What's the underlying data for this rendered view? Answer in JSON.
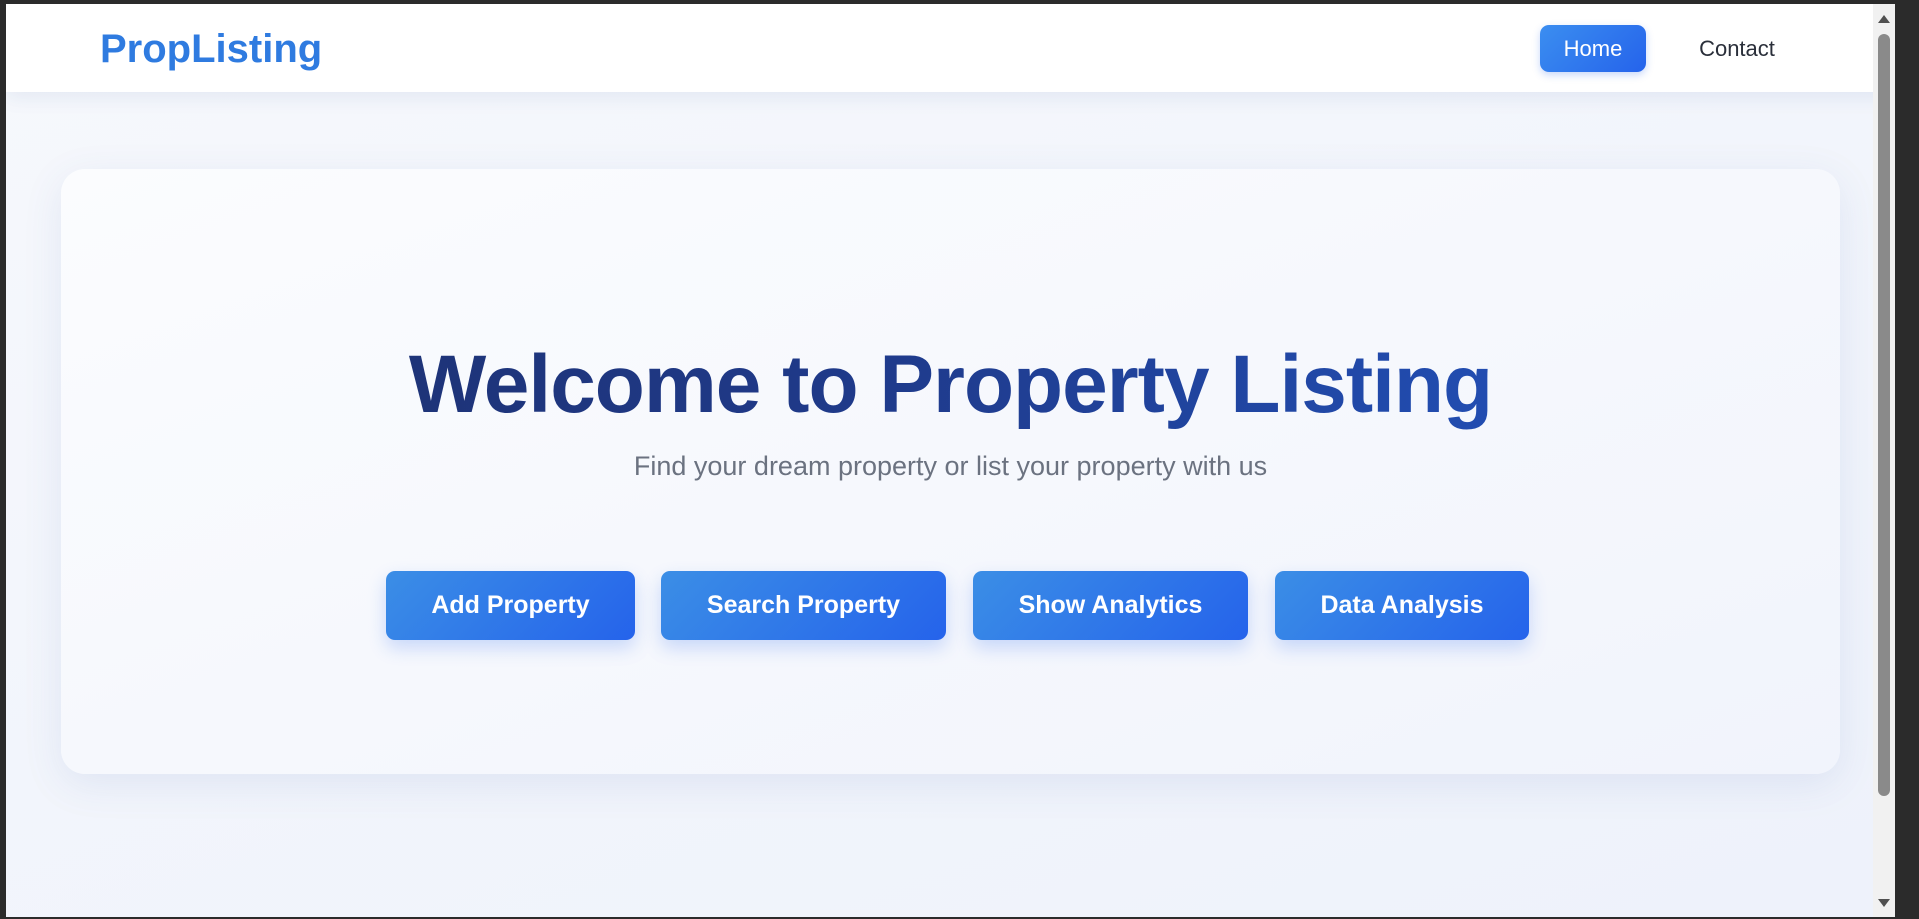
{
  "navbar": {
    "brand": "PropListing",
    "links": [
      {
        "label": "Home",
        "active": true
      },
      {
        "label": "Contact",
        "active": false
      }
    ]
  },
  "hero": {
    "title": "Welcome to Property Listing",
    "subtitle": "Find your dream property or list your property with us",
    "buttons": [
      {
        "label": "Add Property"
      },
      {
        "label": "Search Property"
      },
      {
        "label": "Show Analytics"
      },
      {
        "label": "Data Analysis"
      }
    ]
  },
  "colors": {
    "brand": "#2f7be0",
    "button_start": "#3b8ee6",
    "button_end": "#2563eb",
    "title_dark": "#1e2f6b",
    "title_light": "#2357c6",
    "subtitle": "#6b7280"
  },
  "scrollbar": {
    "up_icon": "triangle-up-icon",
    "down_icon": "triangle-down-icon"
  }
}
